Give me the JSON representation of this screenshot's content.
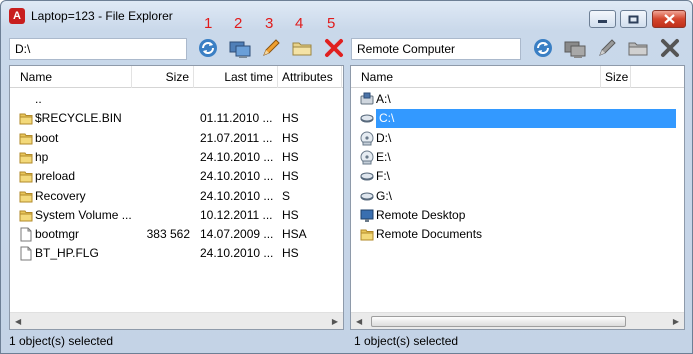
{
  "window": {
    "title": "Laptop=123 - File Explorer",
    "app_icon_letter": "A",
    "accent_color": "#3399ff"
  },
  "step_numbers": [
    "1",
    "2",
    "3",
    "4",
    "5"
  ],
  "left": {
    "path": "D:\\",
    "columns": {
      "name": "Name",
      "size": "Size",
      "last_time": "Last time",
      "attributes": "Attributes"
    },
    "rows": [
      {
        "icon": "parent-dir",
        "name": "..",
        "size": "",
        "time": "",
        "attr": ""
      },
      {
        "icon": "folder",
        "name": "$RECYCLE.BIN",
        "size": "",
        "time": "01.11.2010  ...",
        "attr": "HS"
      },
      {
        "icon": "folder",
        "name": "boot",
        "size": "",
        "time": "21.07.2011  ...",
        "attr": "HS"
      },
      {
        "icon": "folder",
        "name": "hp",
        "size": "",
        "time": "24.10.2010  ...",
        "attr": "HS"
      },
      {
        "icon": "folder",
        "name": "preload",
        "size": "",
        "time": "24.10.2010  ...",
        "attr": "HS"
      },
      {
        "icon": "folder",
        "name": "Recovery",
        "size": "",
        "time": "24.10.2010  ...",
        "attr": "S"
      },
      {
        "icon": "folder",
        "name": "System Volume ...",
        "size": "",
        "time": "10.12.2011  ...",
        "attr": "HS"
      },
      {
        "icon": "file",
        "name": "bootmgr",
        "size": "383 562",
        "time": "14.07.2009  ...",
        "attr": "HSA"
      },
      {
        "icon": "file",
        "name": "BT_HP.FLG",
        "size": "",
        "time": "24.10.2010  ...",
        "attr": "HS"
      }
    ],
    "status": "1 object(s) selected"
  },
  "right": {
    "path": "Remote Computer",
    "columns": {
      "name": "Name",
      "size": "Size"
    },
    "rows": [
      {
        "icon": "floppy-drive",
        "name": "A:\\",
        "selected": false
      },
      {
        "icon": "hard-drive",
        "name": "C:\\",
        "selected": true
      },
      {
        "icon": "cd-drive",
        "name": "D:\\",
        "selected": false
      },
      {
        "icon": "cd-drive",
        "name": "E:\\",
        "selected": false
      },
      {
        "icon": "hard-drive",
        "name": "F:\\",
        "selected": false
      },
      {
        "icon": "hard-drive",
        "name": "G:\\",
        "selected": false
      },
      {
        "icon": "remote-desktop",
        "name": "Remote Desktop",
        "selected": false
      },
      {
        "icon": "folder",
        "name": "Remote Documents",
        "selected": false
      }
    ],
    "status": "1 object(s) selected"
  },
  "toolbar_icons": [
    "refresh-icon",
    "copy-to-computer-icon",
    "rename-pencil-icon",
    "new-folder-icon",
    "delete-x-icon"
  ]
}
